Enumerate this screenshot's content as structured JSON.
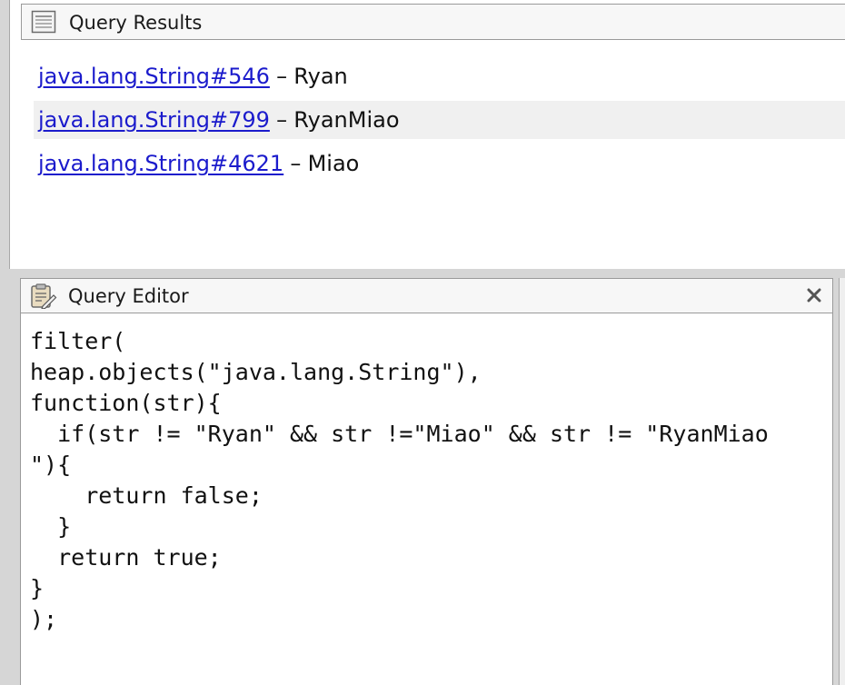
{
  "query_results": {
    "title": "Query Results",
    "icon": "results-list-icon",
    "rows": [
      {
        "link": "java.lang.String#546",
        "separator": "–",
        "value": "Ryan"
      },
      {
        "link": "java.lang.String#799",
        "separator": "–",
        "value": "RyanMiao"
      },
      {
        "link": "java.lang.String#4621",
        "separator": "–",
        "value": "Miao"
      }
    ]
  },
  "query_editor": {
    "title": "Query Editor",
    "icon": "clipboard-edit-icon",
    "close_icon": "close-icon",
    "code": "filter(\nheap.objects(\"java.lang.String\"),\nfunction(str){\n  if(str != \"Ryan\" && str !=\"Miao\" && str != \"RyanMiao\n\"){\n    return false;\n  }\n  return true;\n}\n);"
  },
  "colors": {
    "link": "#1b1bcc",
    "alt_row": "#f0f0f0",
    "panel_header": "#f7f7f7",
    "frame": "#d6d6d6"
  }
}
